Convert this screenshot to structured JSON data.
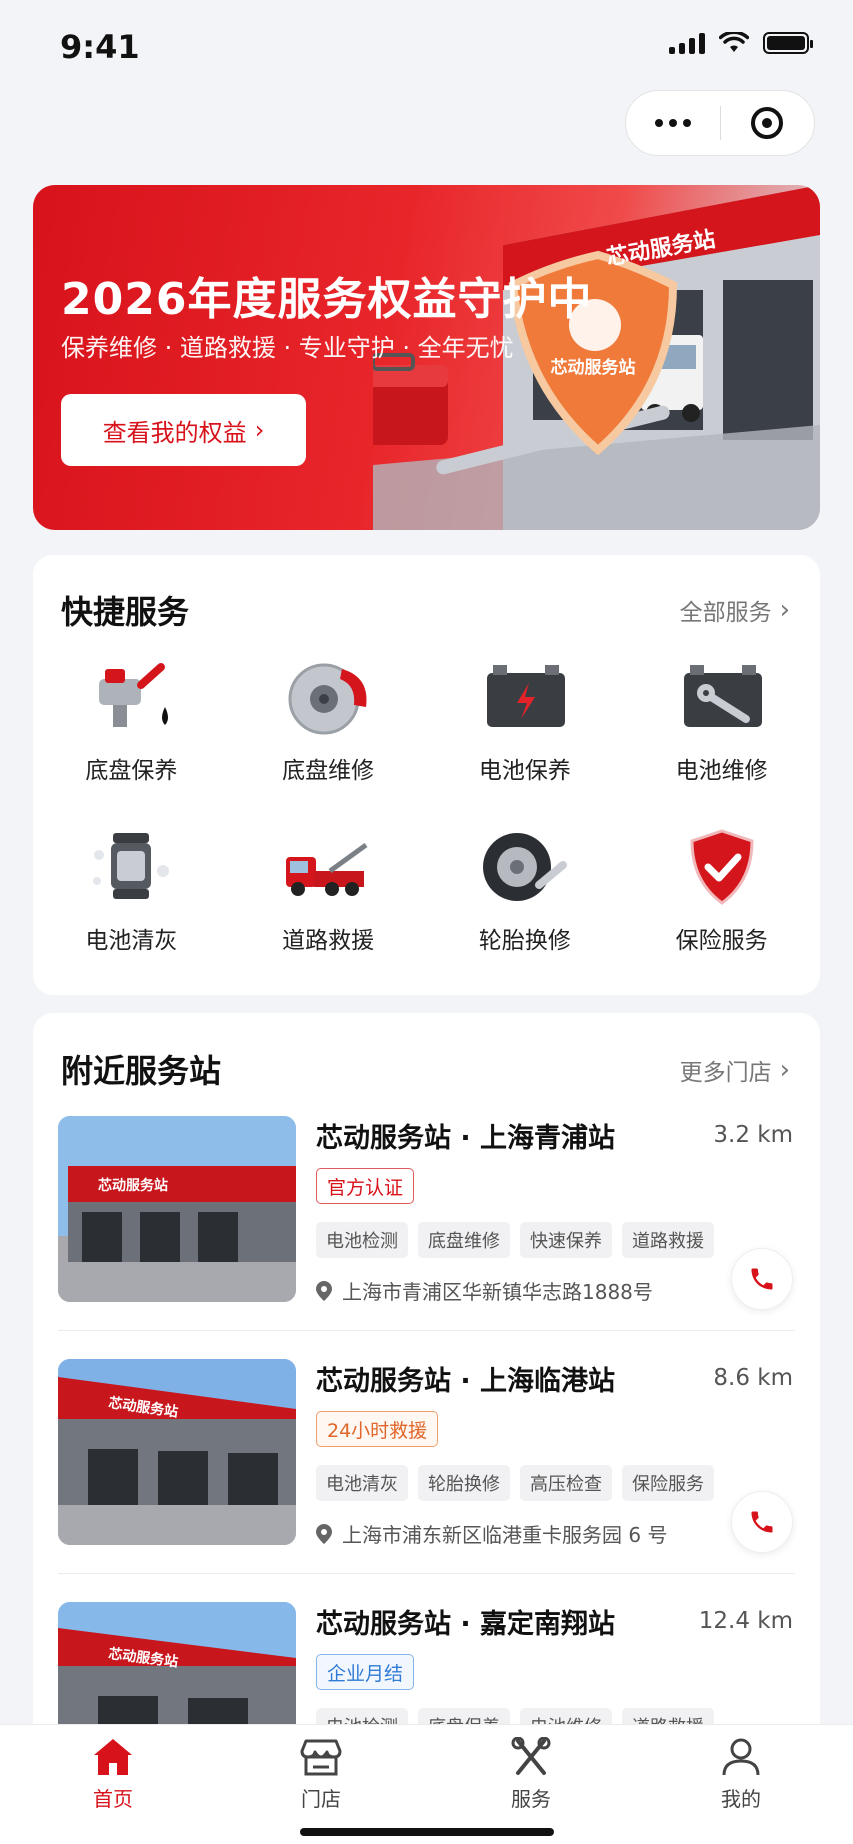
{
  "status_bar": {
    "time": "9:41"
  },
  "banner": {
    "title": "2026年度服务权益守护中",
    "subtitle": "保养维修 · 道路救援 · 专业守护 · 全年无忧",
    "button_label": "查看我的权益",
    "sign_text": "芯动服务站",
    "shield_text": "芯动服务站"
  },
  "quick_services": {
    "title": "快捷服务",
    "more_label": "全部服务",
    "items": [
      {
        "label": "底盘保养",
        "icon": "chassis-maintenance-icon"
      },
      {
        "label": "底盘维修",
        "icon": "brake-disc-icon"
      },
      {
        "label": "电池保养",
        "icon": "battery-lightning-icon"
      },
      {
        "label": "电池维修",
        "icon": "battery-wrench-icon"
      },
      {
        "label": "电池清灰",
        "icon": "battery-cleaning-icon"
      },
      {
        "label": "道路救援",
        "icon": "tow-truck-icon"
      },
      {
        "label": "轮胎换修",
        "icon": "tire-icon"
      },
      {
        "label": "保险服务",
        "icon": "shield-check-icon"
      }
    ]
  },
  "nearby": {
    "title": "附近服务站",
    "more_label": "更多门店",
    "stations": [
      {
        "name": "芯动服务站 · 上海青浦站",
        "distance": "3.2 km",
        "badge": "官方认证",
        "tags": [
          "电池检测",
          "底盘维修",
          "快速保养",
          "道路救援"
        ],
        "address": "上海市青浦区华新镇华志路1888号",
        "sign": "芯动服务站"
      },
      {
        "name": "芯动服务站 · 上海临港站",
        "distance": "8.6 km",
        "badge": "24小时救援",
        "tags": [
          "电池清灰",
          "轮胎换修",
          "高压检查",
          "保险服务"
        ],
        "address": "上海市浦东新区临港重卡服务园 6 号",
        "sign": "芯动服务站"
      },
      {
        "name": "芯动服务站 · 嘉定南翔站",
        "distance": "12.4 km",
        "badge": "企业月结",
        "tags": [
          "电池检测",
          "底盘保养",
          "电池维修",
          "道路救援"
        ],
        "sign": "芯动服务站"
      }
    ]
  },
  "tabbar": {
    "items": [
      {
        "label": "首页",
        "icon": "home-icon",
        "active": true
      },
      {
        "label": "门店",
        "icon": "store-icon",
        "active": false
      },
      {
        "label": "服务",
        "icon": "tools-icon",
        "active": false
      },
      {
        "label": "我的",
        "icon": "user-icon",
        "active": false
      }
    ]
  },
  "colors": {
    "brand_red": "#d8121b",
    "badge_orange": "#e0662a",
    "badge_blue": "#2f7bd6"
  }
}
